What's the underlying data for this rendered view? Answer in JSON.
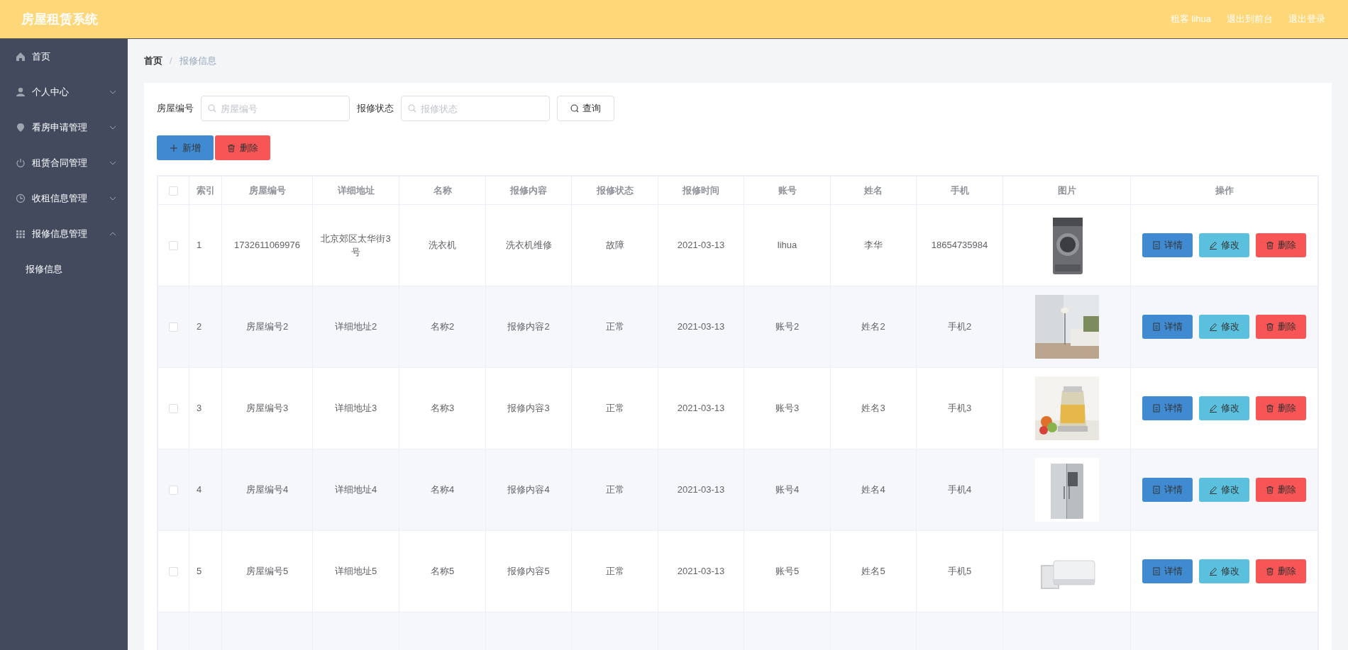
{
  "app_title": "房屋租赁系统",
  "header_links": [
    "租客 lihua",
    "退出到前台",
    "退出登录"
  ],
  "sidebar": {
    "items": [
      {
        "label": "首页"
      },
      {
        "label": "个人中心",
        "expanded": false
      },
      {
        "label": "看房申请管理",
        "expanded": false
      },
      {
        "label": "租赁合同管理",
        "expanded": false
      },
      {
        "label": "收租信息管理",
        "expanded": false
      },
      {
        "label": "报修信息管理",
        "expanded": true,
        "children": [
          {
            "label": "报修信息"
          }
        ]
      }
    ]
  },
  "breadcrumb": {
    "items": [
      "首页",
      "报修信息"
    ],
    "separator": "/"
  },
  "filters": [
    {
      "label": "房屋编号",
      "placeholder": "房屋编号"
    },
    {
      "label": "报修状态",
      "placeholder": "报修状态"
    }
  ],
  "query_button": "查询",
  "add_button": "新增",
  "delete_button": "删除",
  "table": {
    "select_all_checked": false,
    "columns": [
      "索引",
      "房屋编号",
      "详细地址",
      "名称",
      "报修内容",
      "报修状态",
      "报修时间",
      "账号",
      "姓名",
      "手机",
      "图片",
      "操作"
    ],
    "rows": [
      {
        "checked": false,
        "cells": [
          "1",
          "1732611069976",
          "北京郊区太华街3号",
          "洗衣机",
          "洗衣机维修",
          "故障",
          "2021-03-13",
          "lihua",
          "李华",
          "18654735984"
        ],
        "actions": [
          "详情",
          "修改",
          "删除"
        ]
      },
      {
        "checked": false,
        "cells": [
          "2",
          "房屋编号2",
          "详细地址2",
          "名称2",
          "报修内容2",
          "正常",
          "2021-03-13",
          "账号2",
          "姓名2",
          "手机2"
        ],
        "actions": [
          "详情",
          "修改",
          "删除"
        ]
      },
      {
        "checked": false,
        "cells": [
          "3",
          "房屋编号3",
          "详细地址3",
          "名称3",
          "报修内容3",
          "正常",
          "2021-03-13",
          "账号3",
          "姓名3",
          "手机3"
        ],
        "actions": [
          "详情",
          "修改",
          "删除"
        ]
      },
      {
        "checked": false,
        "cells": [
          "4",
          "房屋编号4",
          "详细地址4",
          "名称4",
          "报修内容4",
          "正常",
          "2021-03-13",
          "账号4",
          "姓名4",
          "手机4"
        ],
        "actions": [
          "详情",
          "修改",
          "删除"
        ]
      },
      {
        "checked": false,
        "cells": [
          "5",
          "房屋编号5",
          "详细地址5",
          "名称5",
          "报修内容5",
          "正常",
          "2021-03-13",
          "账号5",
          "姓名5",
          "手机5"
        ],
        "actions": [
          "详情",
          "修改",
          "删除"
        ]
      }
    ]
  }
}
